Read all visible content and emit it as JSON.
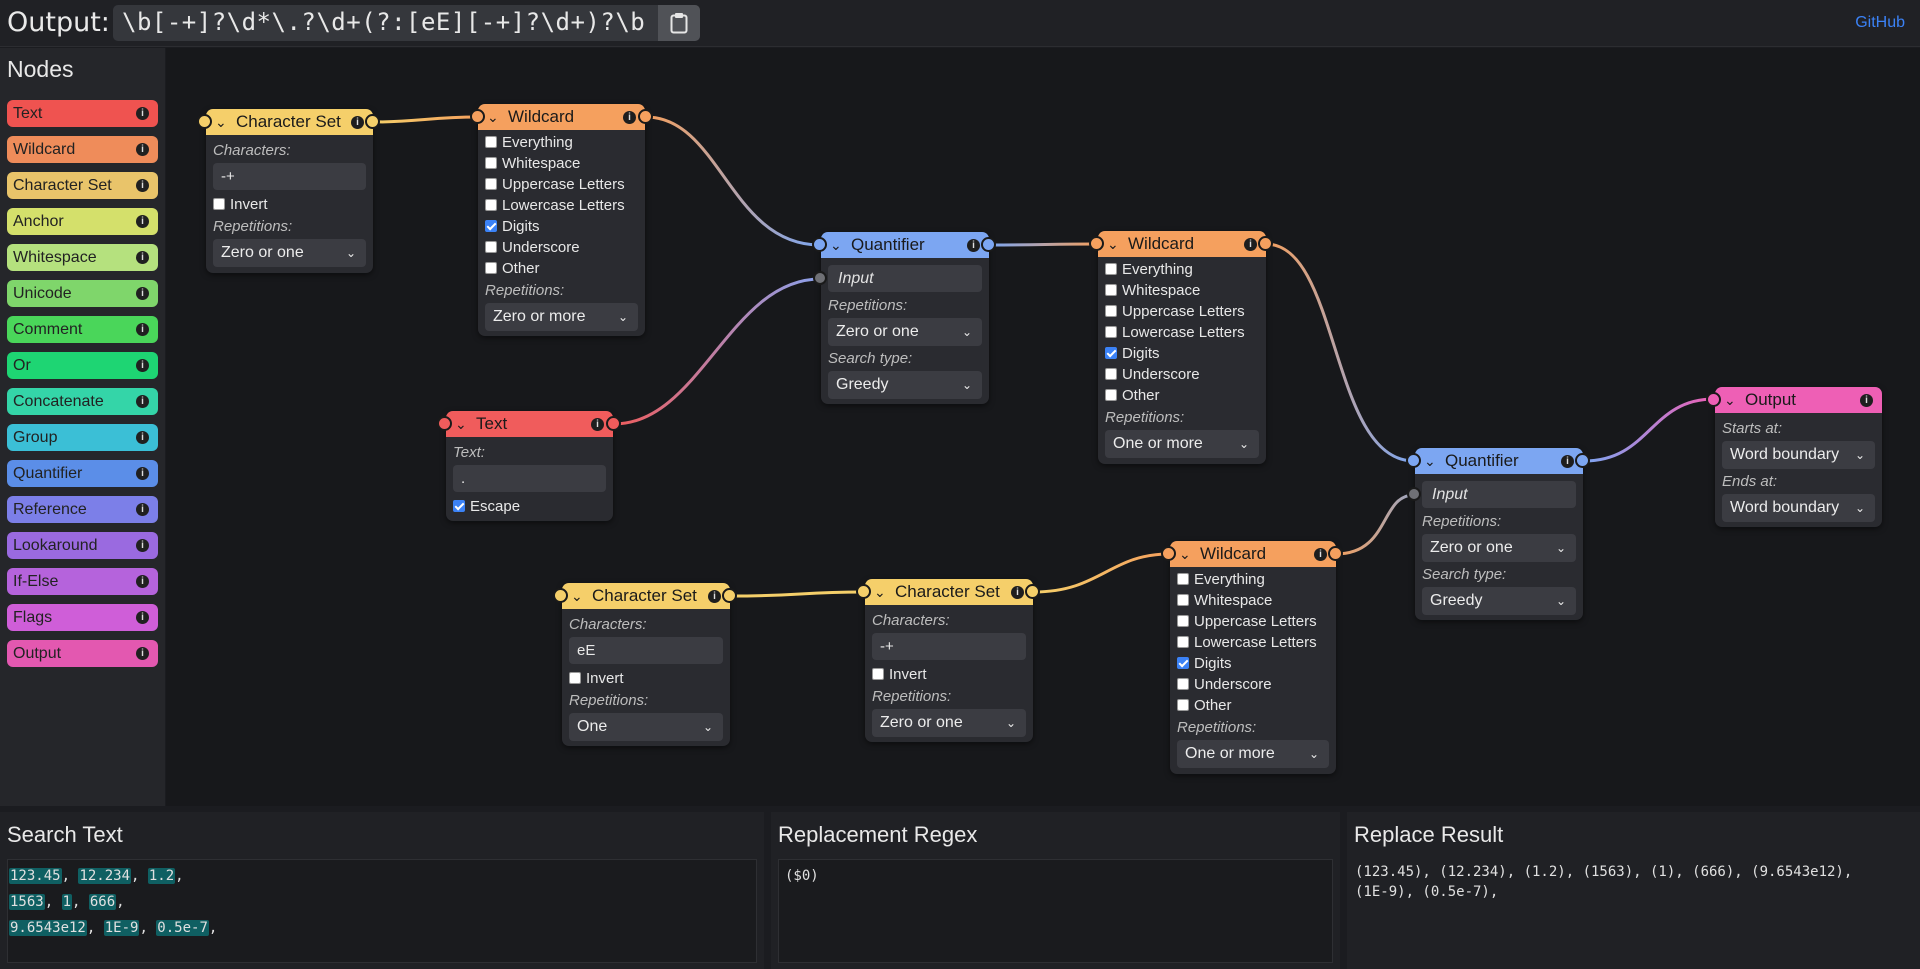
{
  "header": {
    "output_label": "Output:",
    "regex": "\\b[-+]?\\d*\\.?\\d+(?:[eE][-+]?\\d+)?\\b",
    "github": "GitHub"
  },
  "sidebar": {
    "title": "Nodes",
    "items": [
      {
        "label": "Text",
        "color": "#ef5350"
      },
      {
        "label": "Wildcard",
        "color": "#ef8c5a"
      },
      {
        "label": "Character Set",
        "color": "#e9c46a"
      },
      {
        "label": "Anchor",
        "color": "#d4e06b"
      },
      {
        "label": "Whitespace",
        "color": "#b5e17e"
      },
      {
        "label": "Unicode",
        "color": "#7fd66b"
      },
      {
        "label": "Comment",
        "color": "#4ad65a"
      },
      {
        "label": "Or",
        "color": "#1ed573"
      },
      {
        "label": "Concatenate",
        "color": "#34d5a8"
      },
      {
        "label": "Group",
        "color": "#3bbfd6"
      },
      {
        "label": "Quantifier",
        "color": "#5b8ee8"
      },
      {
        "label": "Reference",
        "color": "#7c7fe8"
      },
      {
        "label": "Lookaround",
        "color": "#9a6ae0"
      },
      {
        "label": "If-Else",
        "color": "#b563dc"
      },
      {
        "label": "Flags",
        "color": "#cf5ed8"
      },
      {
        "label": "Output",
        "color": "#e358b0"
      }
    ]
  },
  "nodes": {
    "cs1": {
      "title": "Character Set",
      "chars_label": "Characters:",
      "chars": "-+",
      "invert": "Invert",
      "rep_label": "Repetitions:",
      "rep": "Zero or one"
    },
    "wc1": {
      "title": "Wildcard",
      "opts": [
        "Everything",
        "Whitespace",
        "Uppercase Letters",
        "Lowercase Letters",
        "Digits",
        "Underscore",
        "Other"
      ],
      "rep_label": "Repetitions:",
      "rep": "Zero or more"
    },
    "q1": {
      "title": "Quantifier",
      "input": "Input",
      "rep_label": "Repetitions:",
      "rep": "Zero or one",
      "search_label": "Search type:",
      "search": "Greedy"
    },
    "wc2": {
      "title": "Wildcard",
      "opts": [
        "Everything",
        "Whitespace",
        "Uppercase Letters",
        "Lowercase Letters",
        "Digits",
        "Underscore",
        "Other"
      ],
      "rep_label": "Repetitions:",
      "rep": "One or more"
    },
    "text1": {
      "title": "Text",
      "text_label": "Text:",
      "text": ".",
      "escape": "Escape"
    },
    "out": {
      "title": "Output",
      "starts_label": "Starts at:",
      "starts": "Word boundary",
      "ends_label": "Ends at:",
      "ends": "Word boundary"
    },
    "q2": {
      "title": "Quantifier",
      "input": "Input",
      "rep_label": "Repetitions:",
      "rep": "Zero or one",
      "search_label": "Search type:",
      "search": "Greedy"
    },
    "cs2": {
      "title": "Character Set",
      "chars_label": "Characters:",
      "chars": "eE",
      "invert": "Invert",
      "rep_label": "Repetitions:",
      "rep": "One"
    },
    "cs3": {
      "title": "Character Set",
      "chars_label": "Characters:",
      "chars": "-+",
      "invert": "Invert",
      "rep_label": "Repetitions:",
      "rep": "Zero or one"
    },
    "wc3": {
      "title": "Wildcard",
      "opts": [
        "Everything",
        "Whitespace",
        "Uppercase Letters",
        "Lowercase Letters",
        "Digits",
        "Underscore",
        "Other"
      ],
      "rep_label": "Repetitions:",
      "rep": "One or more"
    }
  },
  "panels": {
    "search_title": "Search Text",
    "search_lines": [
      [
        "123.45",
        ", ",
        "12.234",
        ", ",
        "1.2",
        ","
      ],
      [
        "1563",
        ", ",
        "1",
        ", ",
        "666",
        ","
      ],
      [
        "9.6543e12",
        ", ",
        "1E-9",
        ", ",
        "0.5e-7",
        ","
      ]
    ],
    "replace_title": "Replacement Regex",
    "replace_text": "($0)",
    "result_title": "Replace Result",
    "result_lines": [
      "(123.45), (12.234), (1.2), (1563), (1), (666), (9.6543e12),",
      "(1E-9), (0.5e-7),"
    ]
  }
}
